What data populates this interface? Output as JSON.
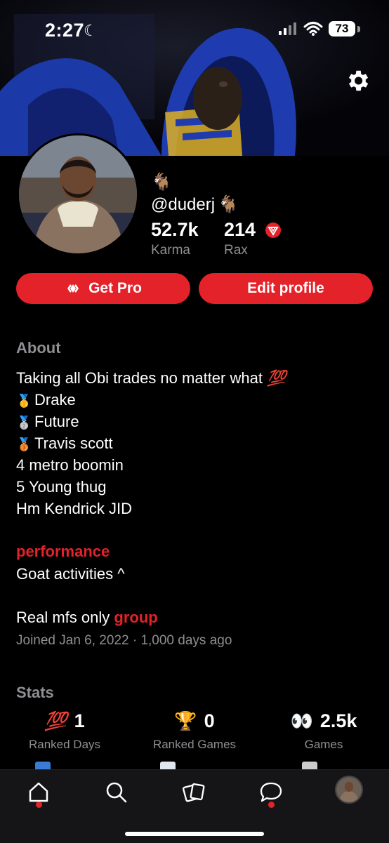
{
  "status_bar": {
    "time": "2:27",
    "battery": "73"
  },
  "profile": {
    "emoji_badge": "🐐",
    "username": "@duderj",
    "username_emoji": "🐐",
    "karma_value": "52.7k",
    "karma_label": "Karma",
    "rax_value": "214",
    "rax_label": "Rax"
  },
  "buttons": {
    "get_pro": "Get Pro",
    "edit_profile": "Edit profile"
  },
  "about": {
    "title": "About",
    "lines": [
      {
        "text": "Taking all Obi trades no matter what",
        "emoji": "💯"
      },
      {
        "medal": "🥇",
        "text": "Drake"
      },
      {
        "medal": "🥈",
        "text": "Future"
      },
      {
        "medal": "🥉",
        "text": "Travis scott"
      },
      {
        "text": "4  metro boomin"
      },
      {
        "text": "5  Young thug"
      },
      {
        "text": "Hm  Kendrick JID"
      }
    ],
    "link_performance": "performance",
    "goat_line": "Goat activities ^",
    "group_prefix": "Real mfs only ",
    "link_group": "group",
    "joined": "Joined Jan 6, 2022 · 1,000 days ago"
  },
  "stats": {
    "title": "Stats",
    "items": [
      {
        "emoji": "💯",
        "value": "1",
        "label": "Ranked Days"
      },
      {
        "emoji": "🏆",
        "value": "0",
        "label": "Ranked Games"
      },
      {
        "emoji": "👀",
        "value": "2.5k",
        "label": "Games"
      }
    ]
  },
  "tabs": [
    "home-tab",
    "search-tab",
    "cards-tab",
    "messages-tab",
    "profile-tab"
  ],
  "colors": {
    "accent": "#e3222a",
    "background": "#000000",
    "muted": "#8e8e93"
  }
}
